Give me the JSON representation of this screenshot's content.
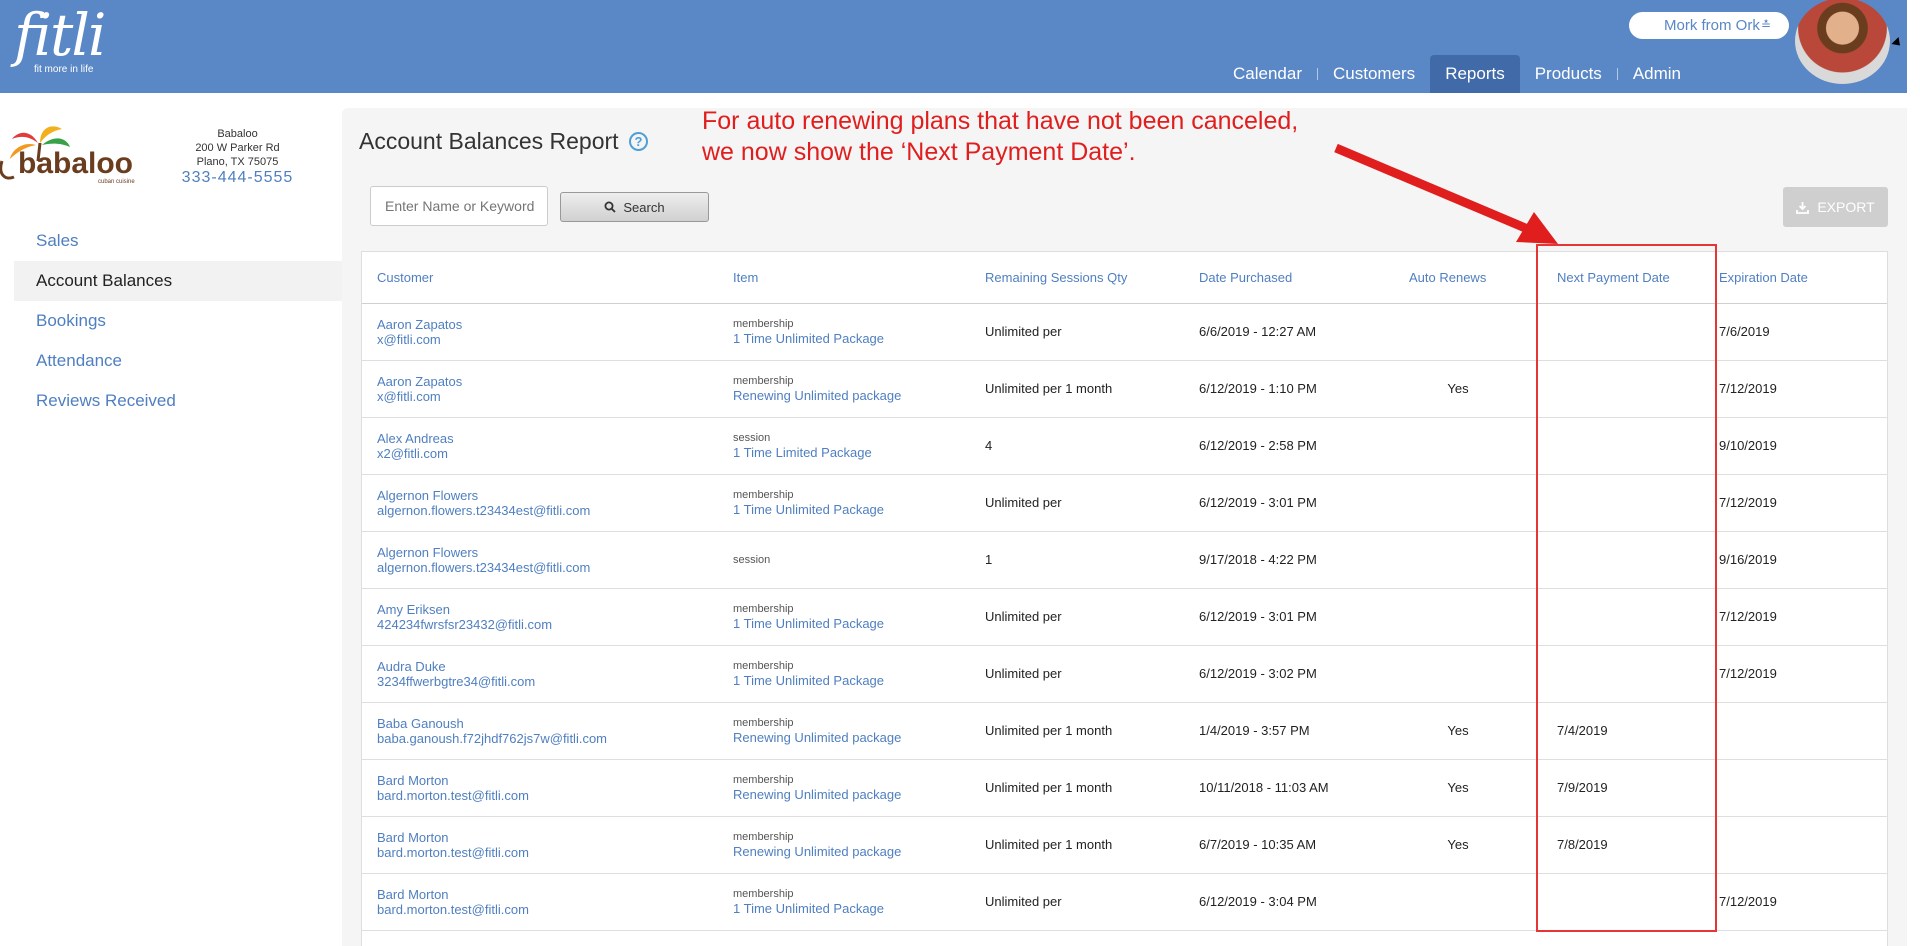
{
  "header": {
    "logo_text": "fitli",
    "logo_tagline": "fit more in life",
    "user_name": "Mork from Ork",
    "nav": [
      {
        "label": "Calendar"
      },
      {
        "label": "Customers"
      },
      {
        "label": "Reports"
      },
      {
        "label": "Products"
      },
      {
        "label": "Admin"
      }
    ],
    "active_nav": "Reports"
  },
  "business": {
    "name": "Babaloo",
    "address1": "200 W Parker Rd",
    "address2": "Plano, TX 75075",
    "phone": "333-444-5555",
    "logo_text": "babaloo",
    "logo_subtext": "cuban cuisine"
  },
  "sidebar": {
    "items": [
      {
        "label": "Sales"
      },
      {
        "label": "Account Balances"
      },
      {
        "label": "Bookings"
      },
      {
        "label": "Attendance"
      },
      {
        "label": "Reviews Received"
      }
    ],
    "active": "Account Balances"
  },
  "main": {
    "title": "Account Balances Report",
    "annotation": "For auto renewing plans that have not been canceled, we now show the ‘Next Payment Date’.",
    "search_placeholder": "Enter Name or Keyword",
    "search_label": "Search",
    "export_label": "EXPORT"
  },
  "table": {
    "columns": [
      "Customer",
      "Item",
      "Remaining Sessions Qty",
      "Date Purchased",
      "Auto Renews",
      "Next Payment Date",
      "Expiration Date"
    ],
    "rows": [
      {
        "name": "Aaron Zapatos",
        "email": "x@fitli.com",
        "type": "membership",
        "item": "1 Time Unlimited Package",
        "remaining": "Unlimited per",
        "purchased": "6/6/2019 - 12:27 AM",
        "auto": "",
        "next": "",
        "expiration": "7/6/2019"
      },
      {
        "name": "Aaron Zapatos",
        "email": "x@fitli.com",
        "type": "membership",
        "item": "Renewing Unlimited package",
        "remaining": "Unlimited per 1 month",
        "purchased": "6/12/2019 - 1:10 PM",
        "auto": "Yes",
        "next": "",
        "expiration": "7/12/2019"
      },
      {
        "name": "Alex Andreas",
        "email": "x2@fitli.com",
        "type": "session",
        "item": "1 Time Limited Package",
        "remaining": "4",
        "purchased": "6/12/2019 - 2:58 PM",
        "auto": "",
        "next": "",
        "expiration": "9/10/2019"
      },
      {
        "name": "Algernon Flowers",
        "email": "algernon.flowers.t23434est@fitli.com",
        "type": "membership",
        "item": "1 Time Unlimited Package",
        "remaining": "Unlimited per",
        "purchased": "6/12/2019 - 3:01 PM",
        "auto": "",
        "next": "",
        "expiration": "7/12/2019"
      },
      {
        "name": "Algernon Flowers",
        "email": "algernon.flowers.t23434est@fitli.com",
        "type": "session",
        "item": "",
        "remaining": "1",
        "purchased": "9/17/2018 - 4:22 PM",
        "auto": "",
        "next": "",
        "expiration": "9/16/2019"
      },
      {
        "name": "Amy Eriksen",
        "email": "424234fwrsfsr23432@fitli.com",
        "type": "membership",
        "item": "1 Time Unlimited Package",
        "remaining": "Unlimited per",
        "purchased": "6/12/2019 - 3:01 PM",
        "auto": "",
        "next": "",
        "expiration": "7/12/2019"
      },
      {
        "name": "Audra Duke",
        "email": "3234ffwerbgtre34@fitli.com",
        "type": "membership",
        "item": "1 Time Unlimited Package",
        "remaining": "Unlimited per",
        "purchased": "6/12/2019 - 3:02 PM",
        "auto": "",
        "next": "",
        "expiration": "7/12/2019"
      },
      {
        "name": "Baba Ganoush",
        "email": "baba.ganoush.f72jhdf762js7w@fitli.com",
        "type": "membership",
        "item": "Renewing Unlimited package",
        "remaining": "Unlimited per 1 month",
        "purchased": "1/4/2019 - 3:57 PM",
        "auto": "Yes",
        "next": "7/4/2019",
        "expiration": ""
      },
      {
        "name": "Bard Morton",
        "email": "bard.morton.test@fitli.com",
        "type": "membership",
        "item": "Renewing Unlimited package",
        "remaining": "Unlimited per 1 month",
        "purchased": "10/11/2018 - 11:03 AM",
        "auto": "Yes",
        "next": "7/9/2019",
        "expiration": ""
      },
      {
        "name": "Bard Morton",
        "email": "bard.morton.test@fitli.com",
        "type": "membership",
        "item": "Renewing Unlimited package",
        "remaining": "Unlimited per 1 month",
        "purchased": "6/7/2019 - 10:35 AM",
        "auto": "Yes",
        "next": "7/8/2019",
        "expiration": ""
      },
      {
        "name": "Bard Morton",
        "email": "bard.morton.test@fitli.com",
        "type": "membership",
        "item": "1 Time Unlimited Package",
        "remaining": "Unlimited per",
        "purchased": "6/12/2019 - 3:04 PM",
        "auto": "",
        "next": "",
        "expiration": "7/12/2019"
      }
    ]
  },
  "colors": {
    "header": "#5a87c5",
    "link": "#4f7fc0",
    "annotation": "#e01e1e"
  }
}
